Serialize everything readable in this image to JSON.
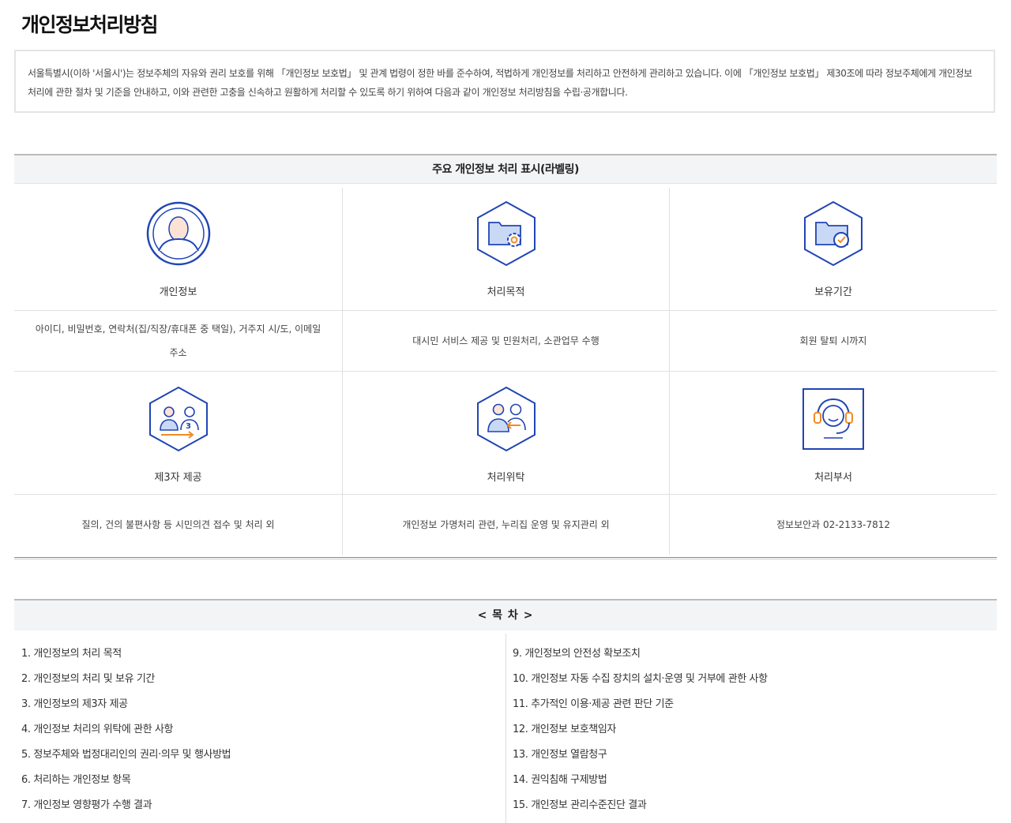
{
  "page": {
    "title": "개인정보처리방침",
    "intro": "서울특별시(이하 '서울시')는 정보주체의 자유와 권리 보호를 위해 「개인정보 보호법」 및 관계 법령이 정한 바를 준수하여, 적법하게 개인정보를 처리하고 안전하게 관리하고 있습니다. 이에 「개인정보 보호법」 제30조에 따라 정보주체에게 개인정보 처리에 관한 절차 및 기준을 안내하고, 이와 관련한 고충을 신속하고 원활하게 처리할 수 있도록 하기 위하여 다음과 같이 개인정보 처리방침을 수립·공개합니다."
  },
  "labeling": {
    "title": "주요 개인정보 처리 표시(라벨링)",
    "items": [
      {
        "label": "개인정보",
        "icon": "person-icon",
        "desc": "아이디, 비밀번호, 연락처(집/직장/휴대폰 중 택일), 거주지 시/도, 이메일 주소"
      },
      {
        "label": "처리목적",
        "icon": "folder-gear-icon",
        "desc": "대시민 서비스 제공 및 민원처리, 소관업무 수행"
      },
      {
        "label": "보유기간",
        "icon": "folder-clock-icon",
        "desc": "회원 탈퇴 시까지"
      },
      {
        "label": "제3자 제공",
        "icon": "third-party-icon",
        "desc": "질의, 건의 불편사항 등 시민의견 접수 및 처리 외"
      },
      {
        "label": "처리위탁",
        "icon": "consignment-icon",
        "desc": "개인정보 가명처리 관련, 누리집 운영 및 유지관리 외"
      },
      {
        "label": "처리부서",
        "icon": "headset-icon",
        "desc": "정보보안과 02-2133-7812"
      }
    ]
  },
  "toc": {
    "title": "< 목 차 >",
    "left": [
      "1. 개인정보의 처리 목적",
      "2. 개인정보의 처리 및 보유 기간",
      "3. 개인정보의 제3자 제공",
      "4. 개인정보 처리의 위탁에 관한 사항",
      "5. 정보주체와 법정대리인의 권리·의무 및 행사방법",
      "6. 처리하는 개인정보 항목",
      "7. 개인정보 영향평가 수행 결과"
    ],
    "right": [
      "9. 개인정보의 안전성 확보조치",
      "10. 개인정보 자동 수집 장치의 설치·운영 및 거부에 관한 사항",
      "11. 추가적인 이용·제공 관련 판단 기준",
      "12. 개인정보 보호책임자",
      "13. 개인정보 열람청구",
      "14. 권익침해 구제방법",
      "15. 개인정보 관리수준진단 결과"
    ]
  },
  "colors": {
    "icon_blue": "#2045b4",
    "icon_light": "#c9d9f5",
    "icon_orange": "#f08a24"
  }
}
